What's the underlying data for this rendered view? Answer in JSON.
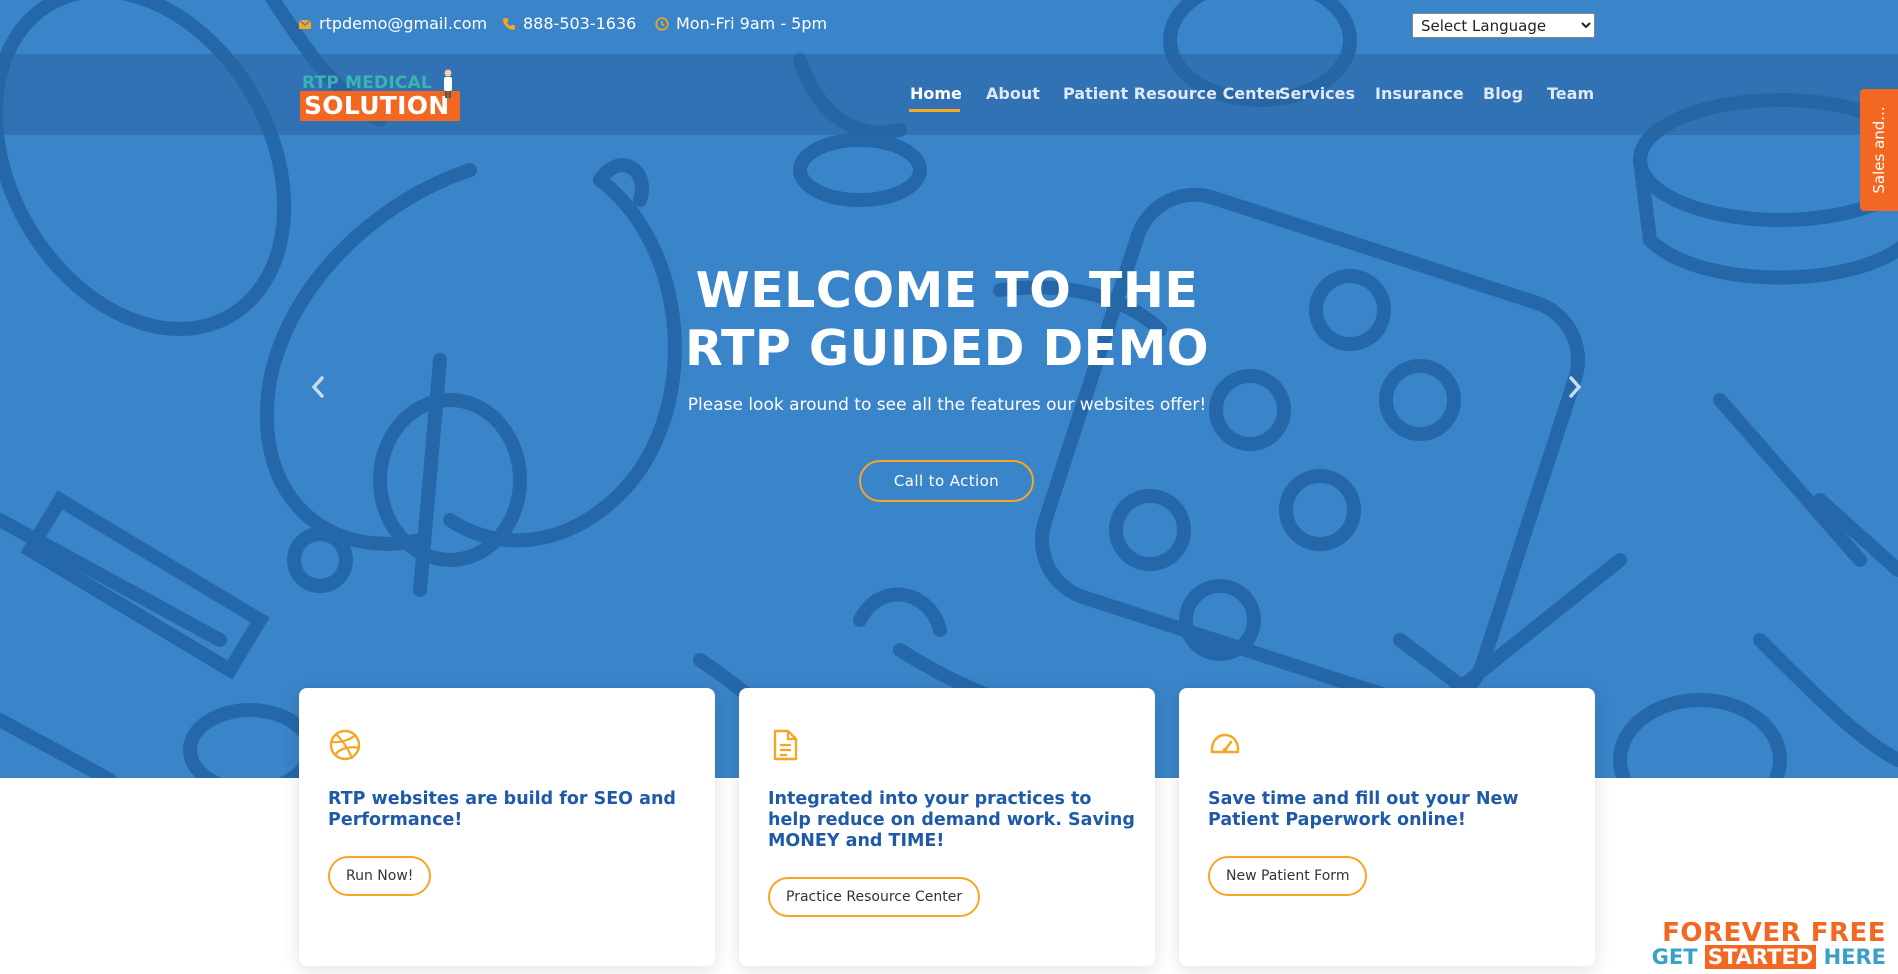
{
  "topbar": {
    "email": "rtpdemo@gmail.com",
    "phone": "888-503-1636",
    "hours": "Mon-Fri 9am - 5pm",
    "language_select": "Select Language"
  },
  "logo": {
    "line1": "RTP MEDICAL",
    "line2": "SOLUTION"
  },
  "nav": {
    "items": [
      "Home",
      "About",
      "Patient Resource Center",
      "Services",
      "Insurance",
      "Blog",
      "Team"
    ],
    "active": "Home"
  },
  "hero": {
    "title_line1": "WELCOME TO THE",
    "title_line2": "RTP GUIDED DEMO",
    "subtitle": "Please look around to see all the features our websites offer!",
    "cta_label": "Call to Action"
  },
  "side_tab": {
    "label": "Sales and..."
  },
  "cards": [
    {
      "icon": "dribbble-icon",
      "text": "RTP websites are build for SEO and Performance!",
      "button": "Run Now!"
    },
    {
      "icon": "document-icon",
      "text": "Integrated into your practices to help reduce on demand work. Saving MONEY and TIME!",
      "button": "Practice Resource Center"
    },
    {
      "icon": "speedometer-icon",
      "text": "Save time and fill out your New Patient Paperwork online!",
      "button": "New Patient Form"
    }
  ],
  "promo": {
    "line1": "FOREVER FREE",
    "line2_a": "GET",
    "line2_b": "STARTED",
    "line2_c": "HERE"
  },
  "colors": {
    "hero_blue": "#3a84c9",
    "accent_orange": "#f5a623",
    "brand_orange": "#f26722",
    "card_text_blue": "#1e5aa8"
  }
}
